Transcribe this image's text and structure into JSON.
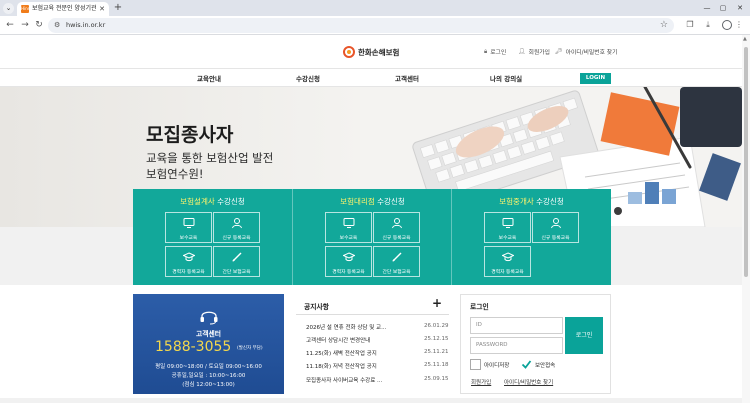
{
  "browser": {
    "tab_title": "보험교육 전문인 양성기관 보험...",
    "tab_favicon_text": "Hins",
    "url": "hwis.in.or.kr"
  },
  "site": {
    "logo_text": "한화손해보험",
    "util_links": [
      {
        "label": "로그인",
        "icon": "lock-icon"
      },
      {
        "label": "회원가입",
        "icon": "user-icon"
      },
      {
        "label": "아이디/비밀번호 찾기",
        "icon": "key-icon"
      }
    ],
    "gnb": [
      "교육안내",
      "수강신청",
      "고객센터",
      "나의 강의실"
    ],
    "login_button": "LOGIN"
  },
  "hero": {
    "title": "모집종사자",
    "subtitle_line1": "교육을 통한 보험산업 발전",
    "subtitle_line2": "보험연수원!"
  },
  "panels": [
    {
      "title_highlight": "보험설계사",
      "title_rest": " 수강신청",
      "buttons": [
        {
          "label": "보수교육",
          "icon": "monitor-icon"
        },
        {
          "label": "신규 등록교육",
          "icon": "person-icon"
        },
        {
          "label": "경력자 등록교육",
          "icon": "graduation-cap-icon"
        },
        {
          "label": "간단 보험교육",
          "icon": "pen-icon"
        }
      ]
    },
    {
      "title_highlight": "보험대리점",
      "title_rest": " 수강신청",
      "buttons": [
        {
          "label": "보수교육",
          "icon": "monitor-icon"
        },
        {
          "label": "신규 등록교육",
          "icon": "person-icon"
        },
        {
          "label": "경력자 등록교육",
          "icon": "graduation-cap-icon"
        },
        {
          "label": "간단 보험교육",
          "icon": "pen-icon"
        }
      ]
    },
    {
      "title_highlight": "보험중개사",
      "title_rest": " 수강신청",
      "buttons": [
        {
          "label": "보수교육",
          "icon": "monitor-icon"
        },
        {
          "label": "신규 등록교육",
          "icon": "person-icon"
        },
        {
          "label": "경력자 등록교육",
          "icon": "graduation-cap-icon"
        }
      ]
    }
  ],
  "customer_center": {
    "label": "고객센터",
    "phone": "1588-3055",
    "phone_note": "(발신자 부담)",
    "hours_line1": "평일 09:00~18:00 / 토요일 09:00~16:00",
    "hours_line2": "공휴일,일요일 : 10:00~16:00",
    "hours_line3": "(점심 12:00~13:00)"
  },
  "notice": {
    "title": "공지사항",
    "more": "+",
    "items": [
      {
        "text": "2026년 설 연휴 전화 상담 및 교...",
        "date": "26.01.29"
      },
      {
        "text": "고객센터 상담시간 변경안내",
        "date": "25.12.15"
      },
      {
        "text": "11.25(화) 새벽 전산작업 공지",
        "date": "25.11.21"
      },
      {
        "text": "11.18(화) 저녁 전산작업 공지",
        "date": "25.11.18"
      },
      {
        "text": "모집종사자 사이버교육 수강료 ...",
        "date": "25.09.15"
      }
    ]
  },
  "login": {
    "title": "로그인",
    "id_placeholder": "ID",
    "pw_placeholder": "PASSWORD",
    "submit": "로그인",
    "save_id": "아이디저장",
    "secure": "보안접속",
    "signup": "회원가입",
    "find": "아이디/비밀번호 찾기"
  },
  "colors": {
    "teal": "#12a89a",
    "accent_yellow": "#fff36b",
    "cs_blue": "#1f4c93",
    "phone_yellow": "#f4d84c"
  }
}
